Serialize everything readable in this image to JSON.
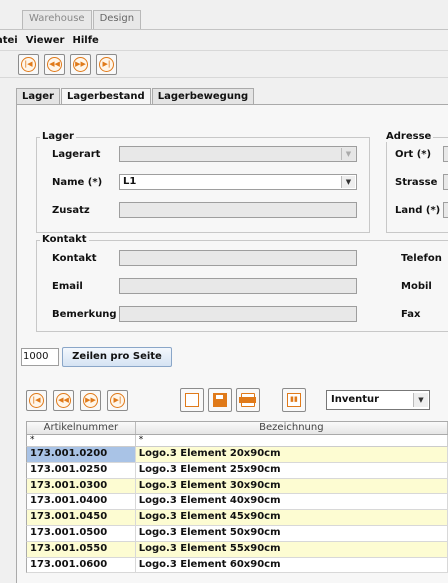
{
  "window_tabs": [
    "Warehouse",
    "Design"
  ],
  "menu": [
    "atei",
    "Viewer",
    "Hilfe"
  ],
  "nav_toolbar": [
    "first-record-icon",
    "previous-record-icon",
    "next-record-icon",
    "last-record-icon"
  ],
  "tabs": [
    "Lager",
    "Lagerbestand",
    "Lagerbewegung"
  ],
  "active_tab": "Lagerbestand",
  "lager_group": {
    "title": "Lager",
    "lagerart_label": "Lagerart",
    "lagerart_value": "",
    "name_label": "Name (*)",
    "name_value": "L1",
    "zusatz_label": "Zusatz",
    "zusatz_value": ""
  },
  "adresse_group": {
    "title": "Adresse",
    "ort_label": "Ort (*)",
    "strasse_label": "Strasse",
    "land_label": "Land (*)"
  },
  "kontakt_group": {
    "title": "Kontakt",
    "kontakt_label": "Kontakt",
    "email_label": "Email",
    "bemerkung_label": "Bemerkung",
    "telefon_label": "Telefon",
    "mobil_label": "Mobil",
    "fax_label": "Fax"
  },
  "rows_per_page": {
    "value": "1000",
    "button_label": "Zeilen pro Seite"
  },
  "report_select": "Inventur",
  "table": {
    "columns": [
      "Artikelnummer",
      "Bezeichnung"
    ],
    "filter": [
      "*",
      "*"
    ],
    "rows": [
      [
        "173.001.0200",
        "Logo.3 Element 20x90cm"
      ],
      [
        "173.001.0250",
        "Logo.3 Element 25x90cm"
      ],
      [
        "173.001.0300",
        "Logo.3 Element 30x90cm"
      ],
      [
        "173.001.0400",
        "Logo.3 Element 40x90cm"
      ],
      [
        "173.001.0450",
        "Logo.3 Element 45x90cm"
      ],
      [
        "173.001.0500",
        "Logo.3 Element 50x90cm"
      ],
      [
        "173.001.0550",
        "Logo.3 Element 55x90cm"
      ],
      [
        "173.001.0600",
        "Logo.3 Element 60x90cm"
      ]
    ]
  },
  "colors": {
    "accent_orange": "#e07a1a",
    "row_highlight": "#fdfcd2",
    "selection": "#a9c3e6"
  }
}
